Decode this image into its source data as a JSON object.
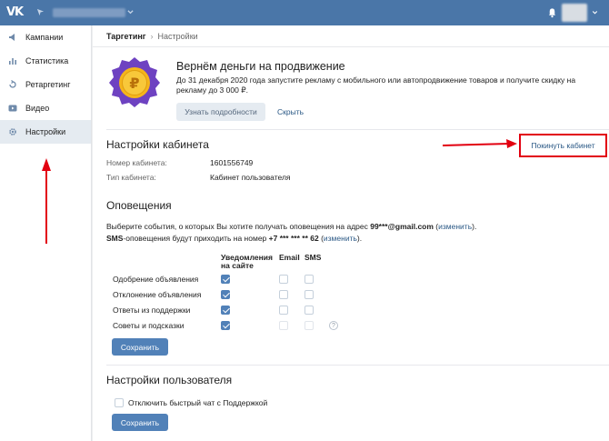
{
  "topbar": {
    "logo": "VK",
    "logo_icon": "vk-logo-icon",
    "flag_icon": "flag-icon",
    "bell_icon": "bell-icon"
  },
  "sidebar": {
    "items": [
      {
        "label": "Кампании",
        "icon": "megaphone-icon"
      },
      {
        "label": "Статистика",
        "icon": "bar-chart-icon"
      },
      {
        "label": "Ретаргетинг",
        "icon": "retarget-icon"
      },
      {
        "label": "Видео",
        "icon": "video-icon"
      },
      {
        "label": "Настройки",
        "icon": "gear-icon",
        "active": true
      }
    ]
  },
  "breadcrumb": {
    "root": "Таргетинг",
    "current": "Настройки"
  },
  "promo": {
    "title": "Вернём деньги на продвижение",
    "text": "До 31 декабря 2020 года запустите рекламу с мобильного или автопродвижение товаров и получите скидку на рекламу до 3 000 ₽.",
    "learn_more": "Узнать подробности",
    "hide": "Скрыть",
    "badge_symbol": "₽"
  },
  "cabinet": {
    "heading": "Настройки кабинета",
    "leave": "Покинуть кабинет",
    "number_label": "Номер кабинета:",
    "number_value": "1601556749",
    "type_label": "Тип кабинета:",
    "type_value": "Кабинет пользователя"
  },
  "notifications": {
    "heading": "Оповещения",
    "line1_prefix": "Выберите события, о которых Вы хотите получать оповещения на адрес ",
    "email": "99***@gmail.com",
    "line1_mid": " (",
    "change1": "изменить",
    "line1_suffix": ").",
    "line2_sms": "SMS",
    "line2_prefix": "-оповещения будут приходить на номер ",
    "phone": "+7 *** *** ** 62",
    "line2_mid": " (",
    "change2": "изменить",
    "line2_suffix": ").",
    "col_site_1": "Уведомления",
    "col_site_2": "на сайте",
    "col_email": "Email",
    "col_sms": "SMS",
    "rows": [
      {
        "label": "Одобрение объявления",
        "site": true,
        "email": false,
        "sms": false
      },
      {
        "label": "Отклонение объявления",
        "site": true,
        "email": false,
        "sms": false
      },
      {
        "label": "Ответы из поддержки",
        "site": true,
        "email": false,
        "sms": false
      },
      {
        "label": "Советы и подсказки",
        "site": true,
        "email": false,
        "sms": false,
        "disabled": true
      }
    ],
    "help": "?",
    "save": "Сохранить"
  },
  "user_settings": {
    "heading": "Настройки пользователя",
    "option": "Отключить быстрый чат с Поддержкой",
    "save": "Сохранить"
  },
  "colors": {
    "topbar": "#4a76a8",
    "accent": "#5181b8",
    "annotation": "#e20010",
    "badge": "#6e42c1",
    "coin": "#f5b51b"
  }
}
